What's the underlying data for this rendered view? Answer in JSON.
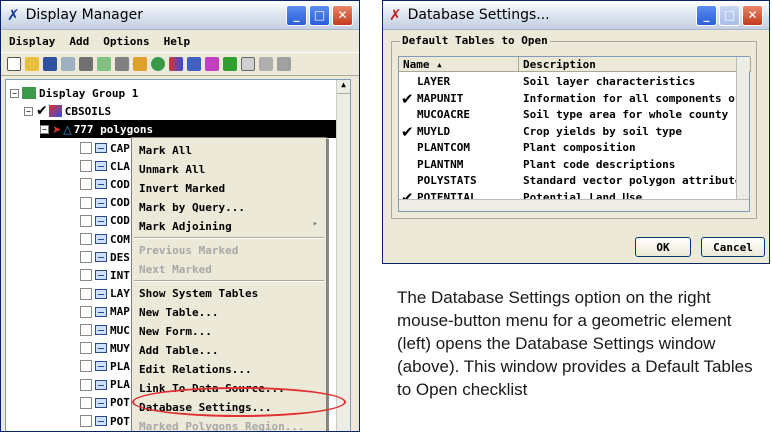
{
  "display_manager": {
    "title": "Display Manager",
    "menu": [
      "Display",
      "Add",
      "Options",
      "Help"
    ],
    "tree": {
      "group": "Display Group 1",
      "layer": "CBSOILS",
      "polygons": "777 polygons",
      "tables": [
        "CAP",
        "CLA",
        "COD",
        "COD",
        "COD",
        "COM",
        "DES",
        "INT",
        "LAY",
        "MAP",
        "MUC",
        "MUY",
        "PLA",
        "PLA",
        "POT",
        "POT"
      ]
    }
  },
  "context_menu": {
    "items": [
      {
        "label": "Mark All",
        "enabled": true
      },
      {
        "label": "Unmark All",
        "enabled": true
      },
      {
        "label": "Invert Marked",
        "enabled": true
      },
      {
        "label": "Mark by Query...",
        "enabled": true
      },
      {
        "label": "Mark Adjoining",
        "enabled": true
      },
      {
        "label": "Previous Marked",
        "enabled": false
      },
      {
        "label": "Next Marked",
        "enabled": false
      },
      {
        "label": "Show System Tables",
        "enabled": true
      },
      {
        "label": "New Table...",
        "enabled": true
      },
      {
        "label": "New Form...",
        "enabled": true
      },
      {
        "label": "Add Table...",
        "enabled": true
      },
      {
        "label": "Edit Relations...",
        "enabled": true
      },
      {
        "label": "Link To Data Source...",
        "enabled": true
      },
      {
        "label": "Database Settings...",
        "enabled": true
      },
      {
        "label": "Marked Polygons Region...",
        "enabled": false
      }
    ]
  },
  "database_settings": {
    "title": "Database Settings...",
    "group_label": "Default Tables to Open",
    "columns": [
      "Name ▴",
      "Description"
    ],
    "rows": [
      {
        "name": "LAYER",
        "description": "Soil layer characteristics",
        "checked": false
      },
      {
        "name": "MAPUNIT",
        "description": "Information for all components of",
        "checked": true
      },
      {
        "name": "MUCOACRE",
        "description": "Soil type area for whole county",
        "checked": false
      },
      {
        "name": "MUYLD",
        "description": "Crop yields by soil type",
        "checked": true
      },
      {
        "name": "PLANTCOM",
        "description": "Plant composition",
        "checked": false
      },
      {
        "name": "PLANTNM",
        "description": "Plant code descriptions",
        "checked": false
      },
      {
        "name": "POLYSTATS",
        "description": "Standard vector polygon attribute",
        "checked": false
      },
      {
        "name": "POTENTIAL",
        "description": "Potential Land Use",
        "checked": true
      }
    ],
    "ok_label": "OK",
    "cancel_label": "Cancel"
  },
  "caption": "The Database Settings option on the right mouse-button menu for a geometric element (left) opens the Database Settings window (above).  This window provides a Default Tables to Open checklist"
}
